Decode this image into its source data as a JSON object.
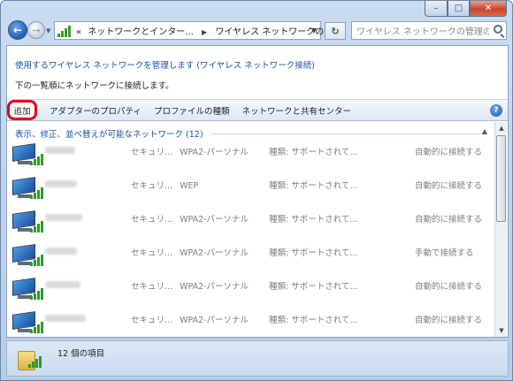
{
  "breadcrumb": {
    "history_arrow": "«",
    "part1": "ネットワークとインター...",
    "part2": "ワイヤレス ネットワークの管理"
  },
  "search": {
    "placeholder": "ワイヤレス ネットワークの管理の検索"
  },
  "header": {
    "title": "使用するワイヤレス ネットワークを管理します (ワイヤレス ネットワーク接続)",
    "subtitle": "下の一覧順にネットワークに接続します。"
  },
  "toolbar": {
    "add_label": "追加",
    "adapter_label": "アダプターのプロパティ",
    "profile_label": "プロファイルの種類",
    "center_label": "ネットワークと共有センター"
  },
  "group": {
    "label": "表示、修正、並べ替えが可能なネットワーク (12)"
  },
  "networks": [
    {
      "security_label": "セキュリ...",
      "security": "WPA2-パーソナル",
      "type": "種類: サポートされて...",
      "connect": "自動的に接続する"
    },
    {
      "security_label": "セキュリ...",
      "security": "WEP",
      "type": "種類: サポートされて...",
      "connect": "自動的に接続する"
    },
    {
      "security_label": "セキュリ...",
      "security": "WPA2-パーソナル",
      "type": "種類: サポートされて...",
      "connect": "自動的に接続する"
    },
    {
      "security_label": "セキュリ...",
      "security": "WPA2-パーソナル",
      "type": "種類: サポートされて...",
      "connect": "手動で接続する"
    },
    {
      "security_label": "セキュリ...",
      "security": "WPA2-パーソナル",
      "type": "種類: サポートされて...",
      "connect": "自動的に接続する"
    },
    {
      "security_label": "セキュリ...",
      "security": "WPA2-パーソナル",
      "type": "種類: サポートされて...",
      "connect": "自動的に接続する"
    }
  ],
  "status": {
    "item_count": "12 個の項目"
  },
  "colors": {
    "link_blue": "#1a4fa3",
    "highlight_red": "#e3001b",
    "window_frame": "#b6cde8"
  }
}
